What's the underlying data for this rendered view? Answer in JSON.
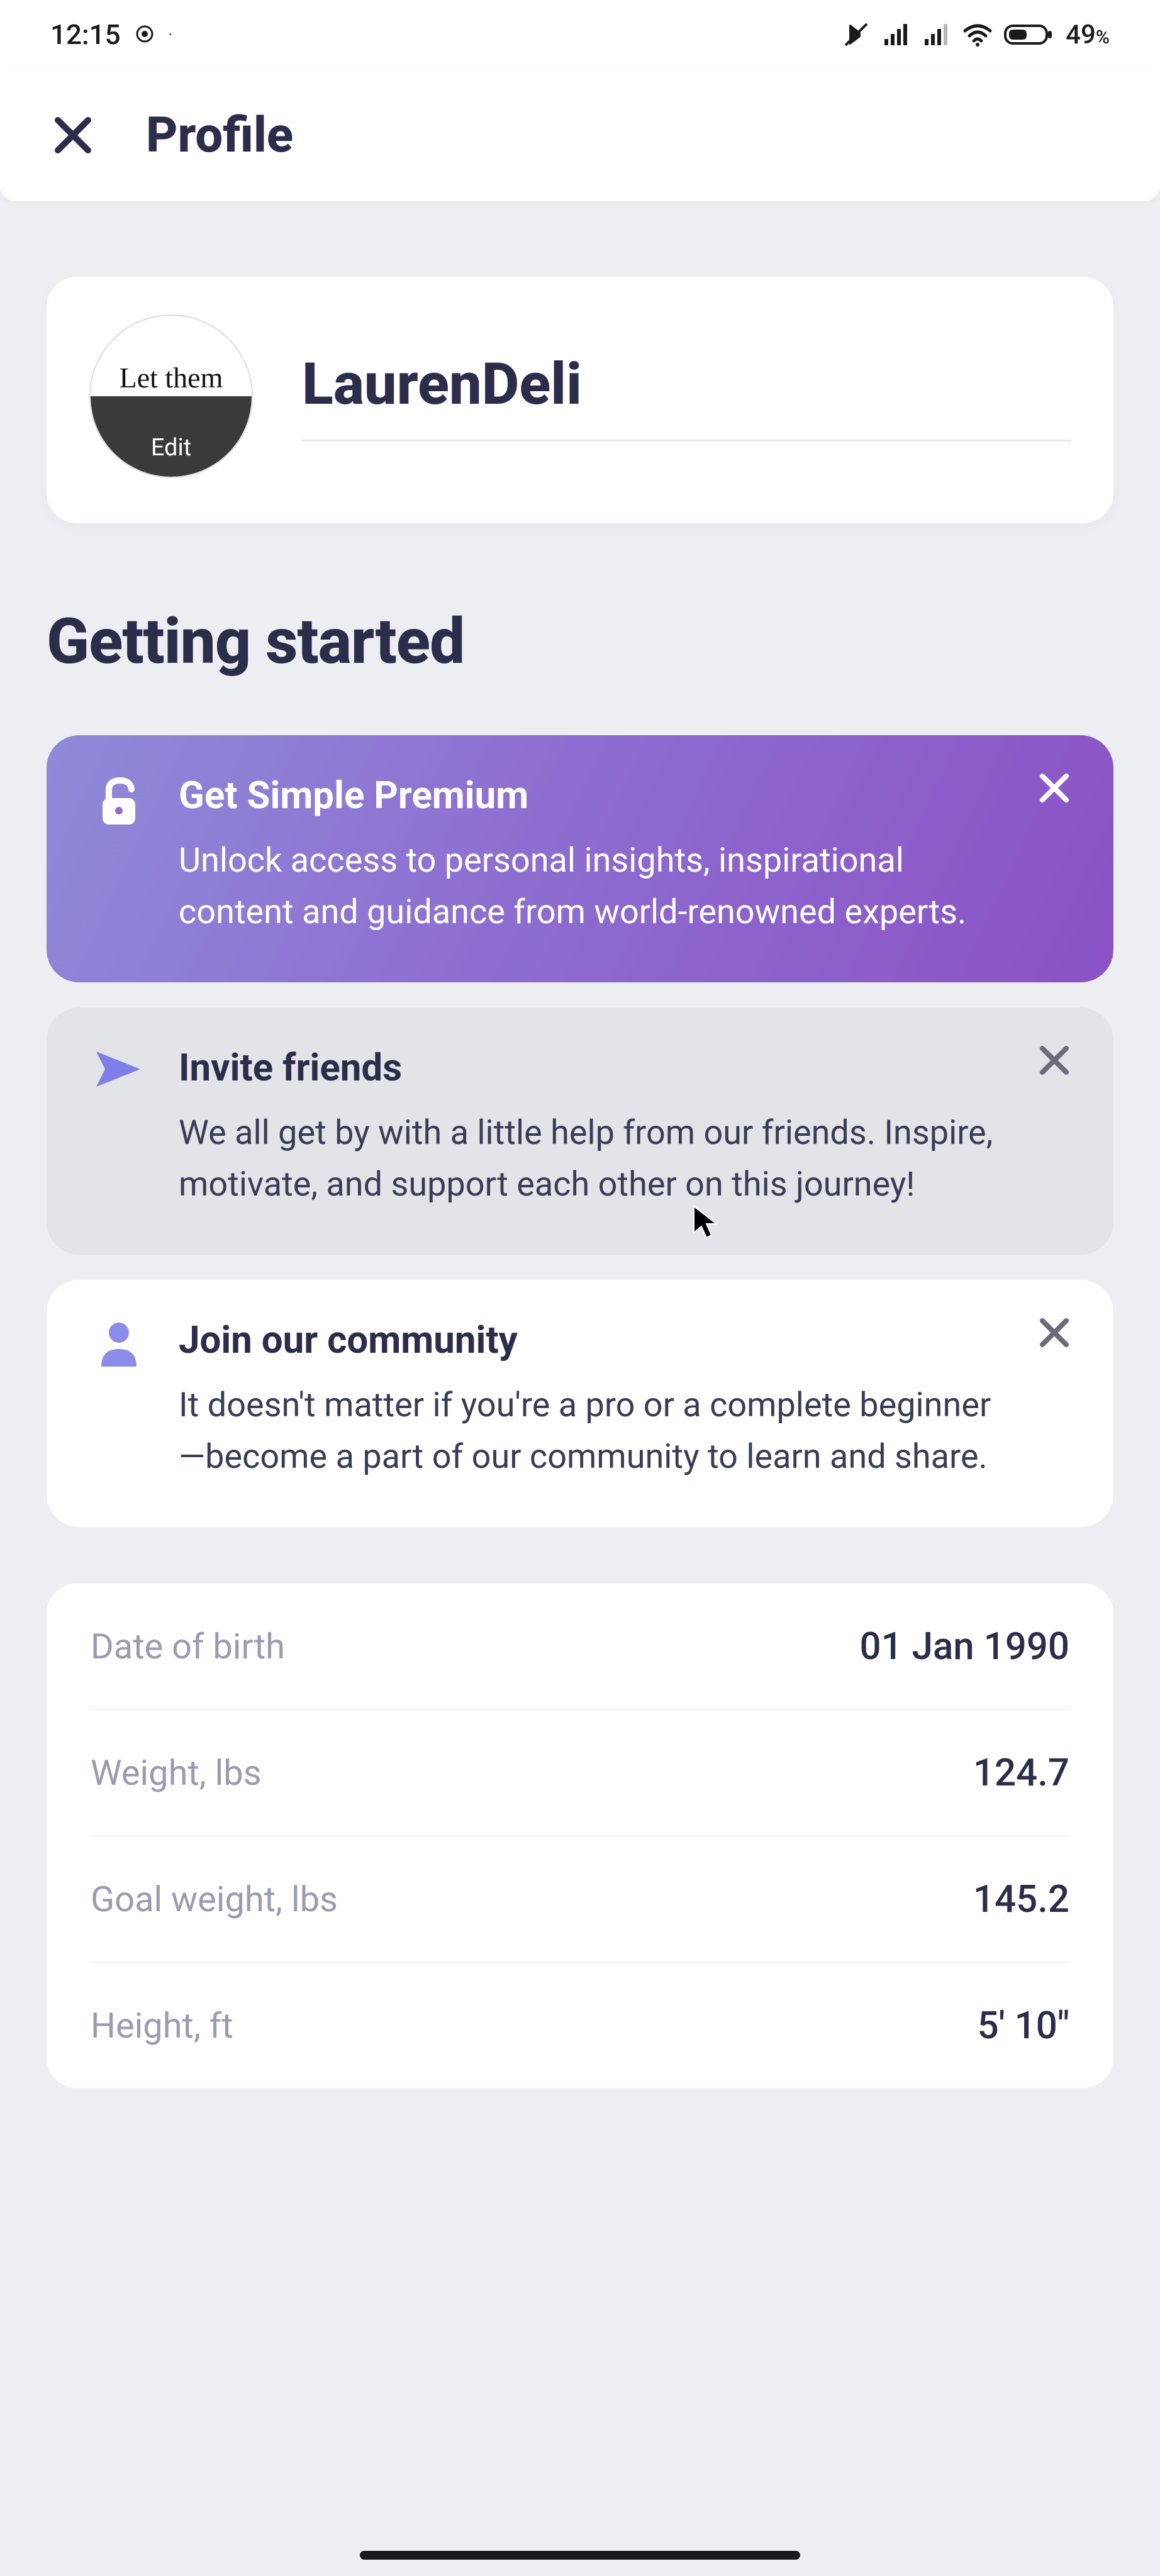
{
  "statusbar": {
    "time": "12:15",
    "battery_text": "49",
    "battery_pct_suffix": "%"
  },
  "header": {
    "title": "Profile"
  },
  "profile": {
    "avatar_script": "Let them",
    "avatar_edit": "Edit",
    "username": "LaurenDeli"
  },
  "section_heading": "Getting started",
  "cards": [
    {
      "title": "Get Simple Premium",
      "text": "Unlock access to personal insights, inspirational content and guidance from world-renowned experts."
    },
    {
      "title": "Invite friends",
      "text": "We all get by with a little help from our friends. Inspire, motivate, and support each other on this journey!"
    },
    {
      "title": "Join our community",
      "text": "It doesn't matter if you're a pro or a complete beginner—become a part of our community to learn and share."
    }
  ],
  "details": [
    {
      "label": "Date of birth",
      "value": "01 Jan 1990"
    },
    {
      "label": "Weight, lbs",
      "value": "124.7"
    },
    {
      "label": "Goal weight, lbs",
      "value": "145.2"
    },
    {
      "label": "Height, ft",
      "value": "5' 10\""
    }
  ]
}
